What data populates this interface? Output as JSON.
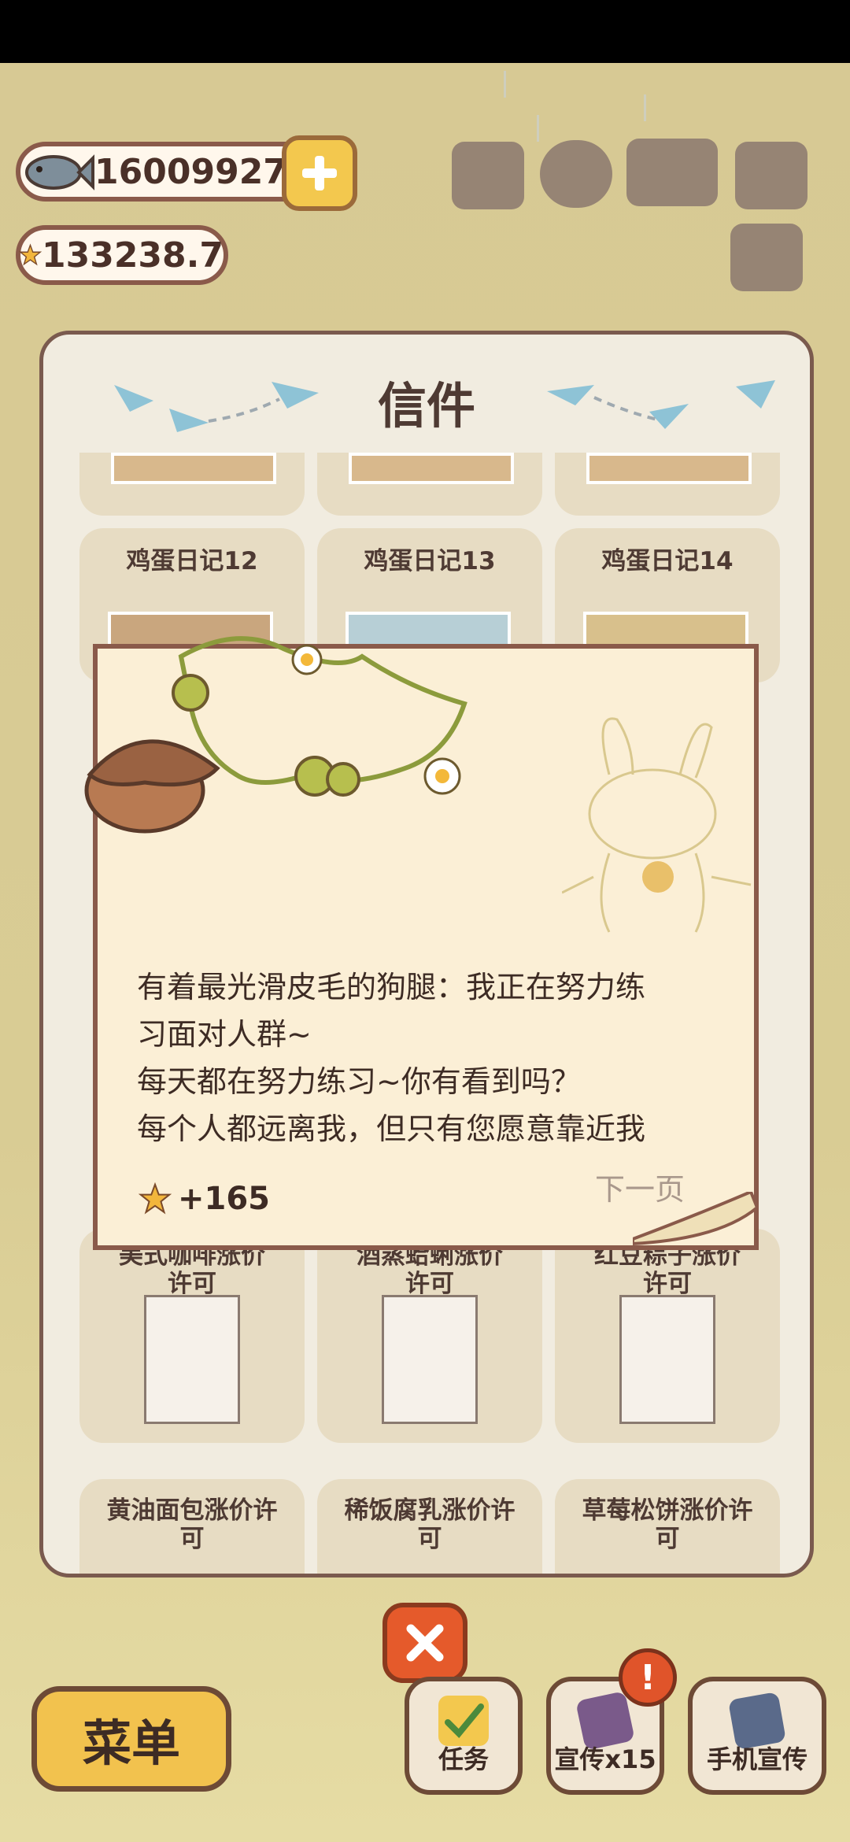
{
  "currency": {
    "fish": "16009927",
    "stars": "133238.7"
  },
  "panel": {
    "title": "信件",
    "row_top": [
      "",
      "",
      ""
    ],
    "row1": [
      "鸡蛋日记12",
      "鸡蛋日记13",
      "鸡蛋日记14"
    ],
    "row_lower1": [
      "美式咖啡涨价许可",
      "酒蒸蛤蜊涨价许可",
      "红豆粽子涨价许可"
    ],
    "row_lower2": [
      "黄油面包涨价许可",
      "稀饭腐乳涨价许可",
      "草莓松饼涨价许可"
    ]
  },
  "letter": {
    "message_lines": [
      "有着最光滑皮毛的狗腿：我正在努力练",
      "习面对人群~",
      "每天都在努力练习~你有看到吗？",
      "每个人都远离我，但只有您愿意靠近我"
    ],
    "reward": "+165",
    "next_label": "下一页"
  },
  "bottom": {
    "menu": "菜单",
    "tasks": "任务",
    "promote": "宣传x15",
    "phone_promote": "手机宣传",
    "alert": "!"
  },
  "colors": {
    "accent": "#f2c24e",
    "close": "#e55a2b",
    "panel_border": "#7a5a4e"
  }
}
